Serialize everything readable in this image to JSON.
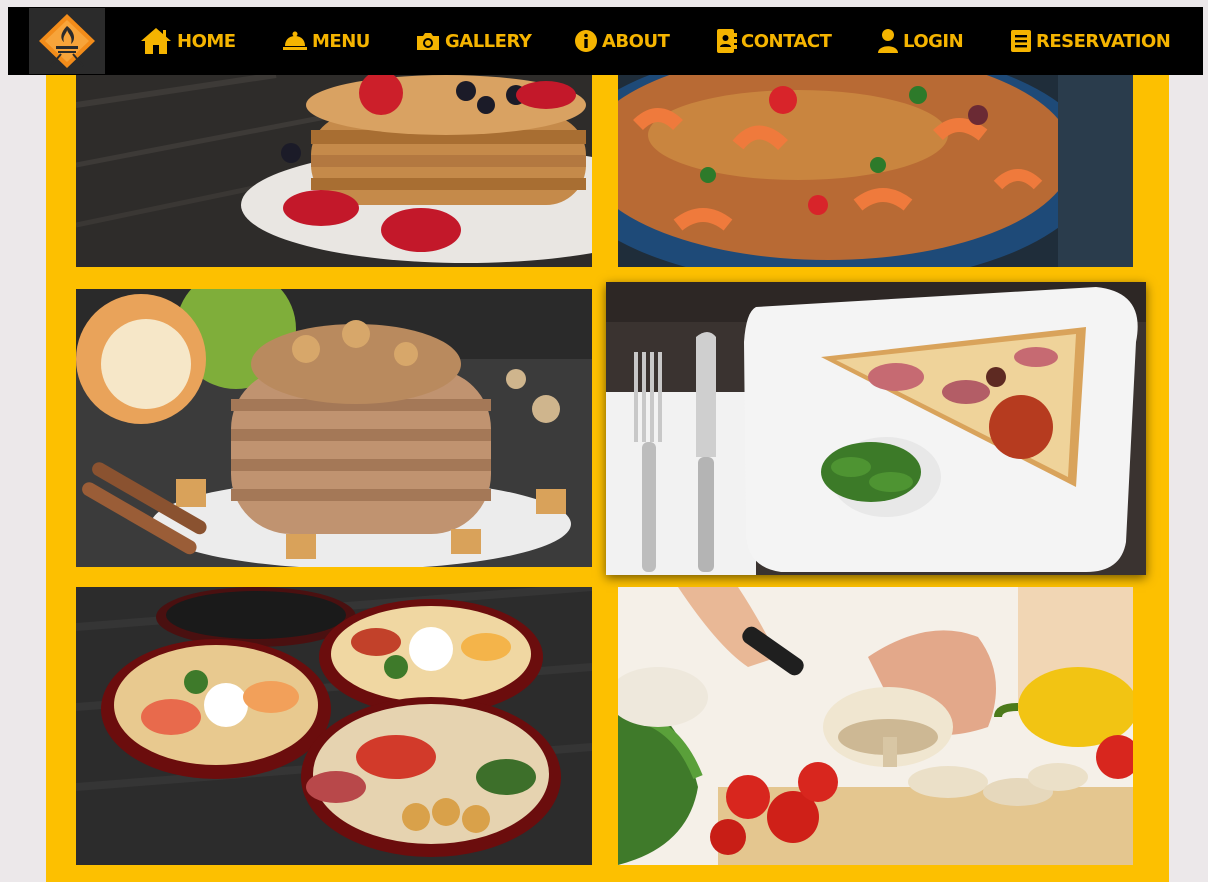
{
  "brand": {
    "logo_icon": "flame-grill-logo",
    "accent_color": "#f5b400",
    "logo_color": "#f28c1a"
  },
  "nav": {
    "items": [
      {
        "label": "HOME",
        "icon": "home-icon"
      },
      {
        "label": "MENU",
        "icon": "cloche-icon"
      },
      {
        "label": "GALLERY",
        "icon": "camera-icon"
      },
      {
        "label": "ABOUT",
        "icon": "info-icon"
      },
      {
        "label": "CONTACT",
        "icon": "contact-book-icon"
      },
      {
        "label": "LOGIN",
        "icon": "user-icon"
      },
      {
        "label": "RESERVATION",
        "icon": "list-icon"
      }
    ]
  },
  "gallery": {
    "background_color": "#fdc000",
    "photos": [
      {
        "subject": "pancake-stack-with-strawberries"
      },
      {
        "subject": "shrimp-paella"
      },
      {
        "subject": "apple-walnut-pancakes"
      },
      {
        "subject": "pizza-slice-on-plate"
      },
      {
        "subject": "sushi-platters"
      },
      {
        "subject": "chef-slicing-vegetables"
      }
    ]
  }
}
